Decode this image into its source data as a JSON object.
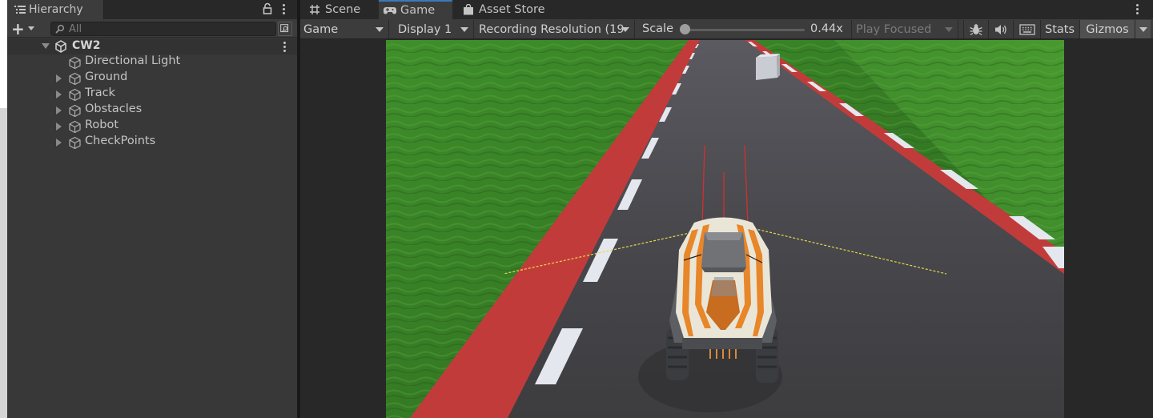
{
  "hierarchy": {
    "tab_title": "Hierarchy",
    "search_placeholder": "All",
    "scene_name": "CW2",
    "items": [
      {
        "label": "Directional Light",
        "expandable": false
      },
      {
        "label": "Ground",
        "expandable": true
      },
      {
        "label": "Track",
        "expandable": true
      },
      {
        "label": "Obstacles",
        "expandable": true
      },
      {
        "label": "Robot",
        "expandable": true
      },
      {
        "label": "CheckPoints",
        "expandable": true
      }
    ]
  },
  "tabs": [
    {
      "label": "Scene",
      "icon": "grid-icon",
      "active": false
    },
    {
      "label": "Game",
      "icon": "gamepad-icon",
      "active": true
    },
    {
      "label": "Asset Store",
      "icon": "shopping-bag-icon",
      "active": false
    }
  ],
  "toolbar": {
    "mode": "Game",
    "display": "Display 1",
    "resolution": "Recording Resolution (19",
    "scale_label": "Scale",
    "scale_value": "0.44x",
    "play_mode": "Play Focused",
    "stats_label": "Stats",
    "gizmos_label": "Gizmos"
  },
  "colors": {
    "accent": "#3a79bb",
    "panel": "#383838",
    "grass": "#3f8a2a",
    "asphalt": "#4a4a4e",
    "curb_red": "#c23b3b",
    "robot_orange": "#e8862a"
  }
}
